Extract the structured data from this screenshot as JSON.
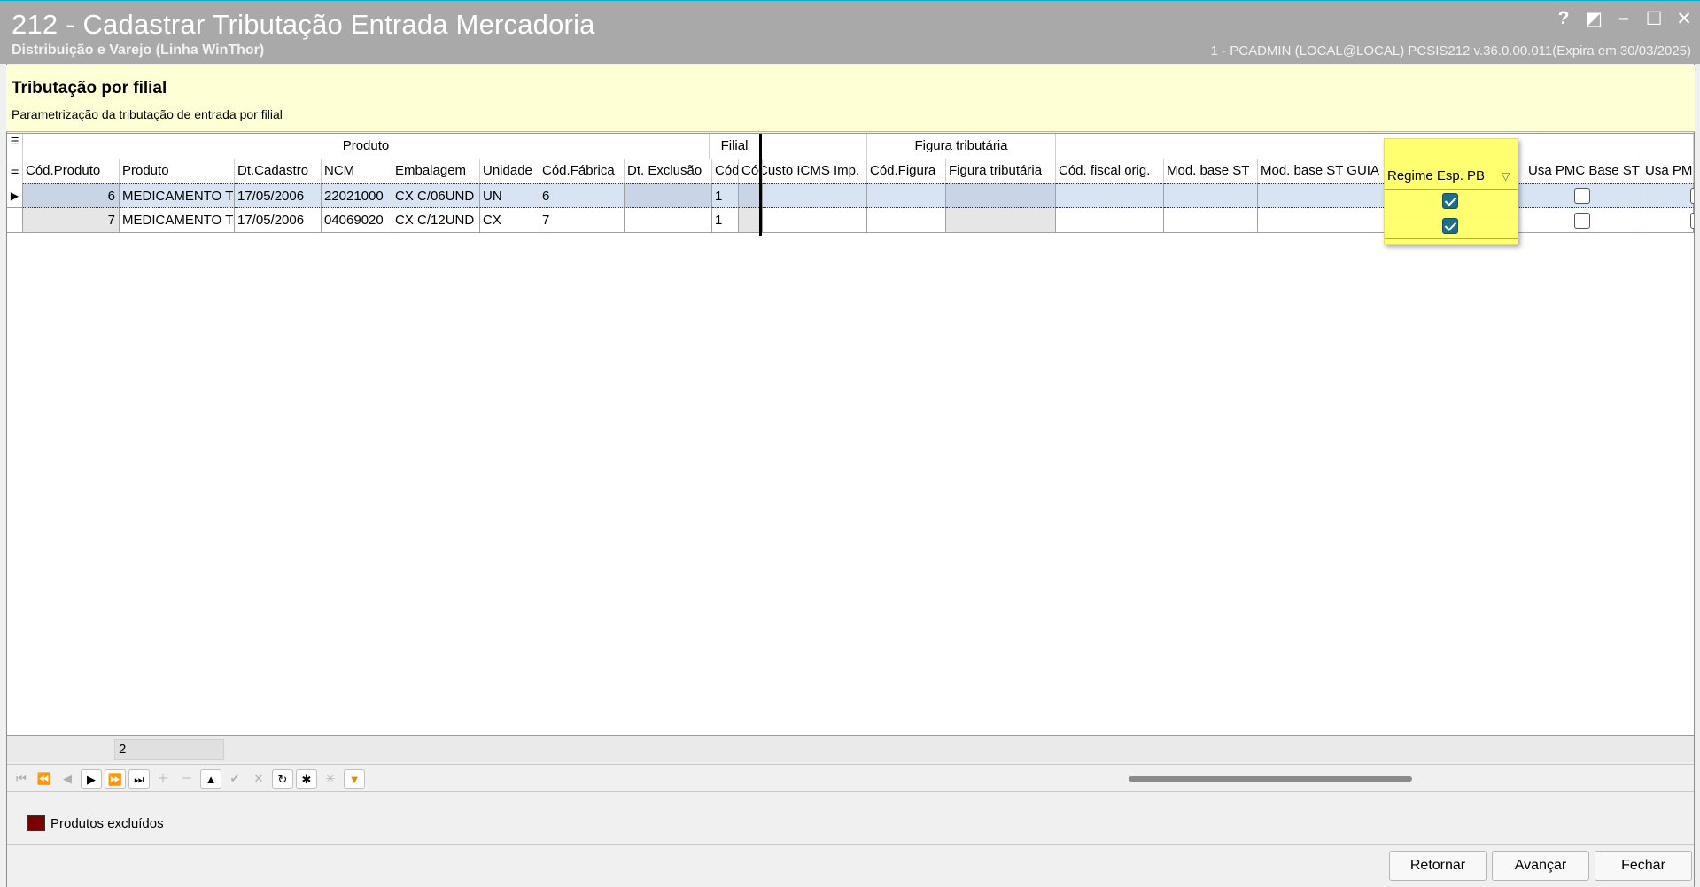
{
  "window": {
    "title": "212 - Cadastrar Tributação Entrada Mercadoria",
    "subtitle": "Distribuição e Varejo (Linha WinThor)",
    "info": "1 - PCADMIN (LOCAL@LOCAL)   PCSIS212  v.36.0.00.011(Expira em 30/03/2025)",
    "buttons": [
      "?",
      "◩",
      "–",
      "☐",
      "✕"
    ]
  },
  "banner": {
    "heading": "Tributação por filial",
    "description": "Parametrização da tributação de entrada por filial"
  },
  "grid": {
    "bands": {
      "produto": "Produto",
      "filial": "Filial",
      "figura": "Figura tributária"
    },
    "columns": [
      "Cód.Produto",
      "Produto",
      "Dt.Cadastro",
      "NCM",
      "Embalagem",
      "Unidade",
      "Cód.Fábrica",
      "Dt. Exclusão",
      "Cód.",
      "Cód.",
      "Custo ICMS Imp.",
      "Cód.Figura",
      "Figura tributária",
      "Cód. fiscal orig.",
      "Mod. base ST",
      "Mod. base ST GUIA",
      "Regime Esp. PB",
      "Usa PMC Base ST",
      "Usa PMPF"
    ],
    "rows": [
      {
        "cod": "6",
        "produto": "MEDICAMENTO TESTE",
        "dtcad": "17/05/2006",
        "ncm": "22021000",
        "emb": "CX C/06UND",
        "un": "UN",
        "codfab": "6",
        "dtexc": "",
        "filial": "1",
        "regime": true,
        "pmc": false
      },
      {
        "cod": "7",
        "produto": "MEDICAMENTO TESTE",
        "dtcad": "17/05/2006",
        "ncm": "04069020",
        "emb": "CX C/12UND",
        "un": "CX",
        "codfab": "7",
        "dtexc": "",
        "filial": "1",
        "regime": true,
        "pmc": false
      }
    ],
    "record_count": "2"
  },
  "legend": {
    "label": "Produtos excluídos",
    "color": "#7a0000"
  },
  "actions": {
    "back": "Retornar",
    "next": "Avançar",
    "close": "Fechar"
  }
}
